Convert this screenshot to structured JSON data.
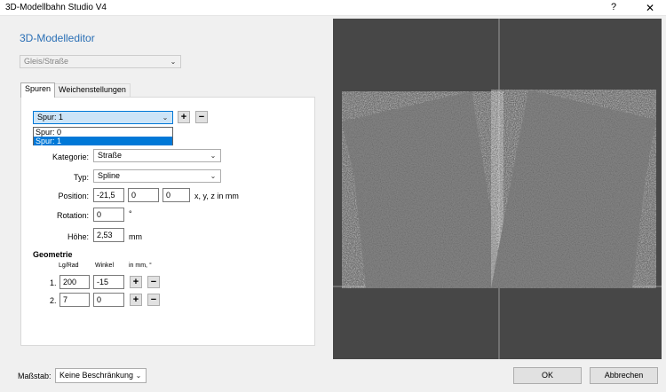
{
  "window": {
    "title": "3D-Modellbahn Studio V4",
    "help_label": "?",
    "close_label": "✕"
  },
  "editor": {
    "title": "3D-Modelleditor"
  },
  "category_select": {
    "value": "Gleis/Straße"
  },
  "tabs": [
    {
      "label": "Spuren",
      "active": true
    },
    {
      "label": "Weichenstellungen",
      "active": false
    }
  ],
  "lane_select": {
    "value": "Spur: 1",
    "options": [
      "Spur: 0",
      "Spur: 1"
    ],
    "selected_index": 1
  },
  "add_button": "+",
  "remove_button": "−",
  "props": {
    "kategorie": {
      "label": "Kategorie:",
      "value": "Straße"
    },
    "typ": {
      "label": "Typ:",
      "value": "Spline"
    },
    "position": {
      "label": "Position:",
      "x": "-21,5",
      "y": "0",
      "z": "0",
      "unit": "x, y, z in mm"
    },
    "rotation": {
      "label": "Rotation:",
      "value": "0",
      "unit": "°"
    },
    "hoehe": {
      "label": "Höhe:",
      "value": "2,53",
      "unit": "mm"
    }
  },
  "geometry": {
    "title": "Geometrie",
    "columns": [
      "Lg/Rad",
      "Winkel",
      "in mm, °"
    ],
    "rows": [
      {
        "index": "1.",
        "length": "200",
        "angle": "-15"
      },
      {
        "index": "2.",
        "length": "7",
        "angle": "0"
      }
    ]
  },
  "viewport": {
    "background": "#474747",
    "texture": "#8a8a8a"
  },
  "scale": {
    "label": "Maßstab:",
    "value": "Keine Beschränkung"
  },
  "ok_button": "OK",
  "cancel_button": "Abbrechen"
}
